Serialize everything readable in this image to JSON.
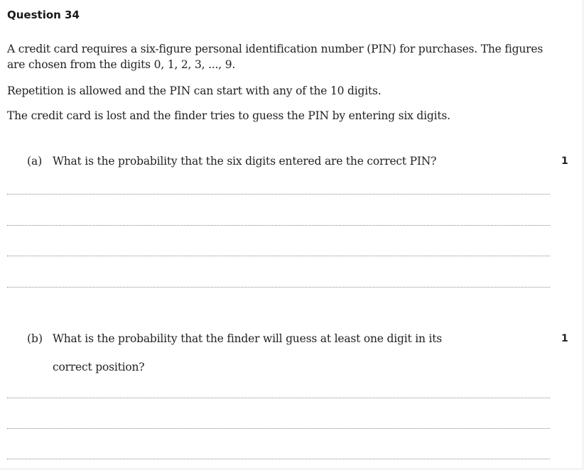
{
  "question": {
    "heading": "Question 34",
    "paragraphs": [
      "A credit card requires a six-figure personal identification number (PIN) for purchases. The figures are chosen from the digits 0, 1, 2, 3, ..., 9.",
      "Repetition is allowed and the PIN can start with any of the 10 digits.",
      "The credit card is lost and the finder tries to guess the PIN by entering six digits."
    ],
    "parts": [
      {
        "label": "(a)",
        "text": "What is the probability that the six digits entered are the correct PIN?",
        "marks": "1"
      },
      {
        "label": "(b)",
        "text_line1": "What is the probability that the finder will guess at least one digit in its",
        "text_line2": "correct position?",
        "marks": "1"
      }
    ]
  }
}
